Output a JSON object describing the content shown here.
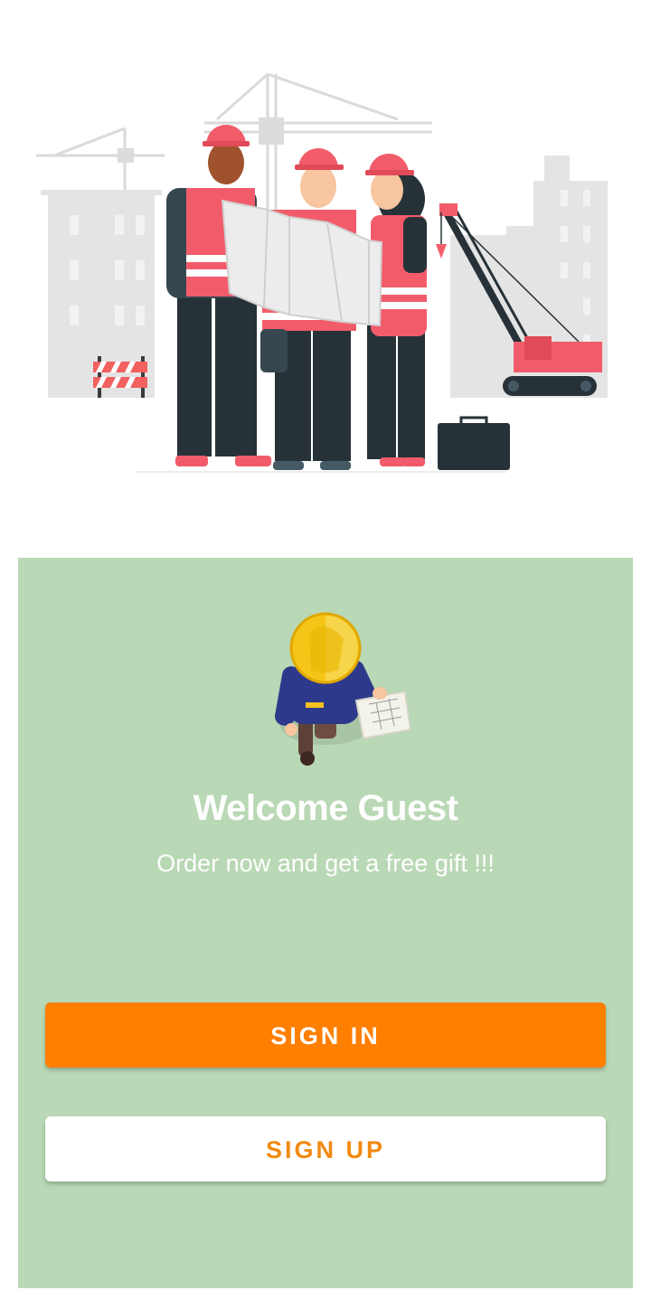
{
  "welcome": {
    "title": "Welcome Guest",
    "subtitle": "Order now and get a free gift !!!"
  },
  "buttons": {
    "sign_in": "SIGN IN",
    "sign_up": "SIGN UP"
  },
  "colors": {
    "card_background": "#b9d8b5",
    "primary_button": "#ff7f00",
    "secondary_button_text": "#f28a12"
  },
  "images": {
    "hero": "construction-team-illustration",
    "avatar": "worker-with-blueprint-illustration"
  }
}
